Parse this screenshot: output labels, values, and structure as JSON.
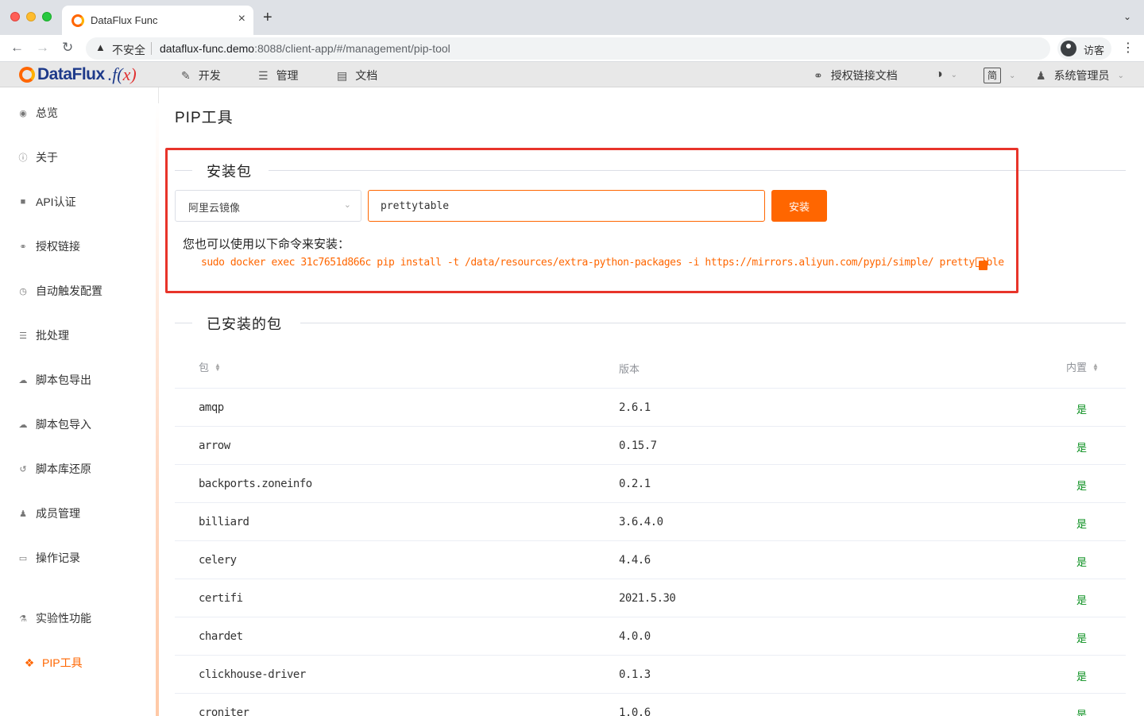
{
  "browser": {
    "tab_title": "DataFlux Func",
    "tab_close": "×",
    "new_tab": "+",
    "tab_menu": "⌄",
    "security_label": "不安全",
    "url_host": "dataflux-func.demo",
    "url_rest": ":8088/client-app/#/management/pip-tool",
    "profile_label": "访客",
    "menu": "⋮"
  },
  "header": {
    "logo_text": "DataFlux",
    "logo_fx": ".f(",
    "logo_x": "x",
    "logo_close": ")",
    "nav": {
      "dev": "开发",
      "mgmt": "管理",
      "docs": "文档",
      "auth_docs": "授权链接文档",
      "lang": "简",
      "user": "系统管理员"
    }
  },
  "sidebar": {
    "items": [
      {
        "label": "总览",
        "icon": "dashboard-icon"
      },
      {
        "label": "关于",
        "icon": "info-icon"
      },
      {
        "label": "API认证",
        "icon": "lock-icon"
      },
      {
        "label": "授权链接",
        "icon": "link-icon"
      },
      {
        "label": "自动触发配置",
        "icon": "clock-icon"
      },
      {
        "label": "批处理",
        "icon": "list-icon"
      },
      {
        "label": "脚本包导出",
        "icon": "cloud-download-icon"
      },
      {
        "label": "脚本包导入",
        "icon": "cloud-upload-icon"
      },
      {
        "label": "脚本库还原",
        "icon": "history-icon"
      },
      {
        "label": "成员管理",
        "icon": "users-icon"
      },
      {
        "label": "操作记录",
        "icon": "keyboard-icon"
      },
      {
        "label": "实验性功能",
        "icon": "flask-icon"
      },
      {
        "label": "PIP工具",
        "icon": "cubes-icon"
      }
    ]
  },
  "main": {
    "title": "PIP工具",
    "install": {
      "section_title": "安装包",
      "mirror": "阿里云镜像",
      "package_value": "prettytable",
      "install_button": "安装",
      "hint": "您也可以使用以下命令来安装：",
      "command": "sudo docker exec 31c7651d866c pip install -t /data/resources/extra-python-packages -i https://mirrors.aliyun.com/pypi/simple/ prettytable"
    },
    "installed": {
      "section_title": "已安装的包",
      "columns": {
        "package": "包",
        "version": "版本",
        "builtin": "内置"
      },
      "rows": [
        {
          "name": "amqp",
          "version": "2.6.1",
          "builtin": "是"
        },
        {
          "name": "arrow",
          "version": "0.15.7",
          "builtin": "是"
        },
        {
          "name": "backports.zoneinfo",
          "version": "0.2.1",
          "builtin": "是"
        },
        {
          "name": "billiard",
          "version": "3.6.4.0",
          "builtin": "是"
        },
        {
          "name": "celery",
          "version": "4.4.6",
          "builtin": "是"
        },
        {
          "name": "certifi",
          "version": "2021.5.30",
          "builtin": "是"
        },
        {
          "name": "chardet",
          "version": "4.0.0",
          "builtin": "是"
        },
        {
          "name": "clickhouse-driver",
          "version": "0.1.3",
          "builtin": "是"
        },
        {
          "name": "croniter",
          "version": "1.0.6",
          "builtin": "是"
        }
      ]
    }
  },
  "colors": {
    "accent": "#ff6600",
    "highlight_border": "#e8342a",
    "builtin_yes": "#0a8f1f"
  }
}
